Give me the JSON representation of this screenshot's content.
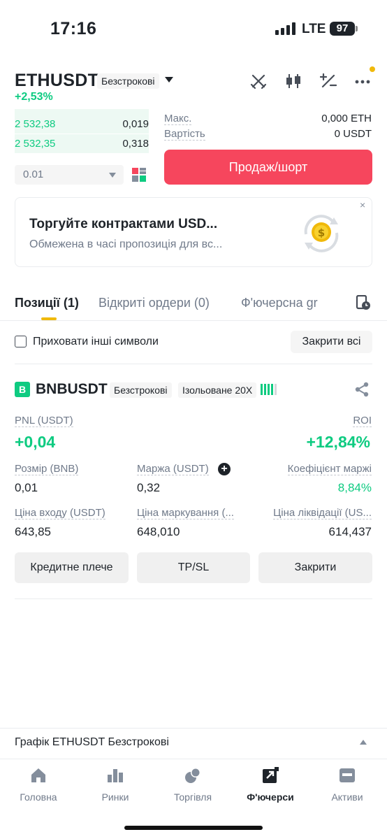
{
  "status_bar": {
    "time": "17:16",
    "network": "LTE",
    "battery": "97"
  },
  "header": {
    "symbol": "ETHUSDT",
    "contract_type": "Безстрокові",
    "change": "+2,53%"
  },
  "order_book": {
    "rows": [
      {
        "price": "2 532,38",
        "qty": "0,019"
      },
      {
        "price": "2 532,35",
        "qty": "0,318"
      }
    ],
    "depth": "0.01"
  },
  "order_form": {
    "max_label": "Макс.",
    "max_value": "0,000 ETH",
    "cost_label": "Вартість",
    "cost_value": "0 USDT",
    "sell_button": "Продаж/шорт"
  },
  "promo": {
    "title": "Торгуйте контрактами USD...",
    "subtitle": "Обмежена в часі пропозиція для вс...",
    "close": "×"
  },
  "tabs": {
    "positions": "Позиції (1)",
    "open_orders": "Відкриті ордери (0)",
    "futures_grid": "Ф'ючерсна gr"
  },
  "filter": {
    "hide_other": "Приховати інші символи",
    "close_all": "Закрити всі"
  },
  "position": {
    "badge": "B",
    "symbol": "BNBUSDT",
    "contract_type": "Безстрокові",
    "margin_mode": "Ізольоване 20X",
    "pnl_label": "PNL (USDT)",
    "pnl_value": "+0,04",
    "roi_label": "ROI",
    "roi_value": "+12,84%",
    "size_label": "Розмір (BNB)",
    "size_value": "0,01",
    "margin_label": "Маржа (USDT)",
    "margin_value": "0,32",
    "margin_ratio_label": "Коефіцієнт маржі",
    "margin_ratio_value": "8,84%",
    "entry_label": "Ціна входу (USDT)",
    "entry_value": "643,85",
    "mark_label": "Ціна маркування (...",
    "mark_value": "648,010",
    "liq_label": "Ціна ліквідації (US...",
    "liq_value": "614,437",
    "leverage_btn": "Кредитне плече",
    "tpsl_btn": "TP/SL",
    "close_btn": "Закрити"
  },
  "chart_bar": {
    "label": "Графік ETHUSDT Безстрокові"
  },
  "bottom_nav": {
    "home": "Головна",
    "markets": "Ринки",
    "trade": "Торгівля",
    "futures": "Ф'ючерси",
    "assets": "Активи"
  },
  "colors": {
    "green": "#0ecb81",
    "red": "#f6465d",
    "accent": "#f0b90b"
  }
}
